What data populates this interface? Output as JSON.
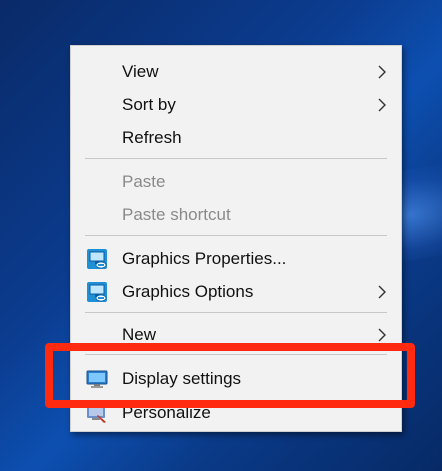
{
  "menu": {
    "view_label": "View",
    "sort_by_label": "Sort by",
    "refresh_label": "Refresh",
    "paste_label": "Paste",
    "paste_shortcut_label": "Paste shortcut",
    "graphics_properties_label": "Graphics Properties...",
    "graphics_options_label": "Graphics Options",
    "new_label": "New",
    "display_settings_label": "Display settings",
    "personalize_label": "Personalize"
  },
  "icons": {
    "submenu": "chevron-right-icon",
    "graphics": "intel-graphics-icon",
    "display": "monitor-icon",
    "personalize": "personalize-icon"
  },
  "colors": {
    "highlight_border": "#ff2a10",
    "menu_background": "#f2f2f2",
    "desktop_background": "#0b3c8f",
    "disabled_text": "#8a8a8a"
  }
}
